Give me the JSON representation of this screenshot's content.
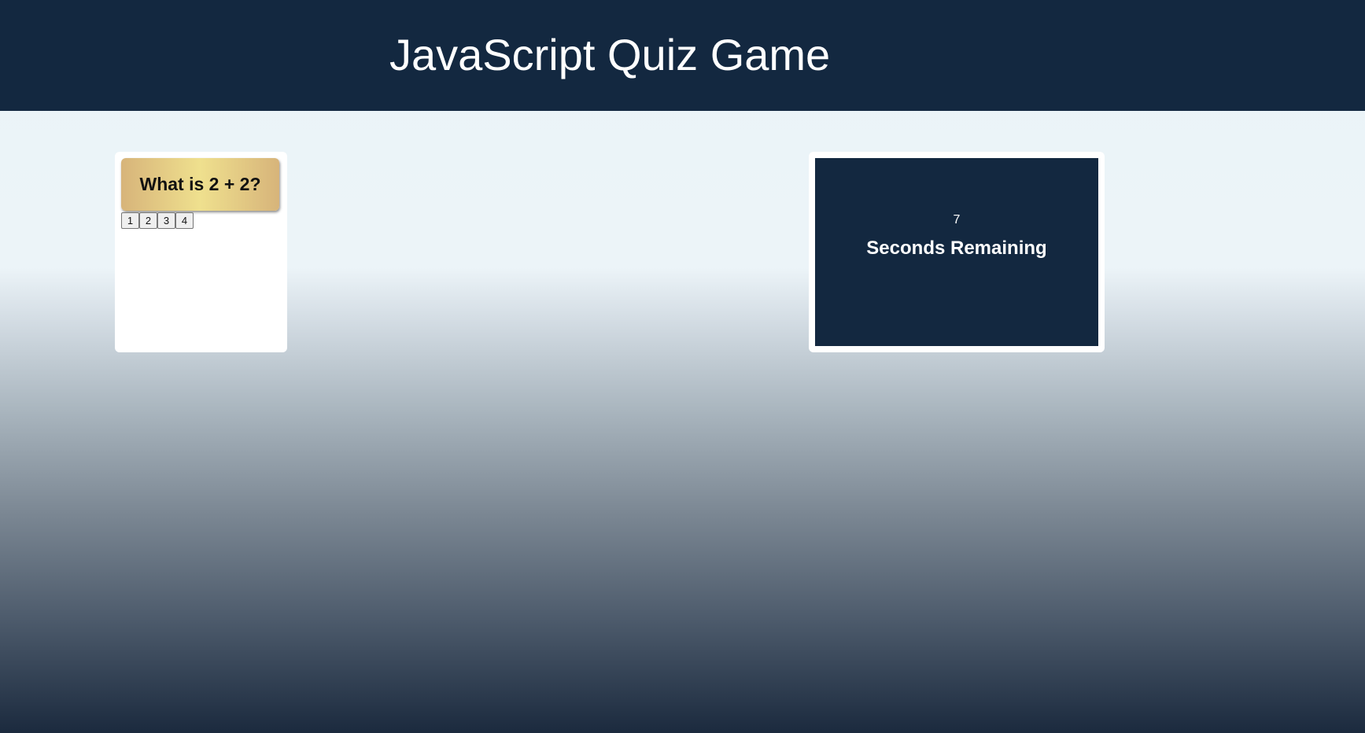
{
  "header": {
    "title": "JavaScript Quiz Game"
  },
  "quiz": {
    "question": "What is 2 + 2?",
    "answers": [
      "1",
      "2",
      "3",
      "4"
    ]
  },
  "timer": {
    "seconds": "7",
    "label": "Seconds Remaining"
  },
  "colors": {
    "header_bg": "#132840",
    "question_card": "#efe08e",
    "timer_bg": "#132840"
  }
}
